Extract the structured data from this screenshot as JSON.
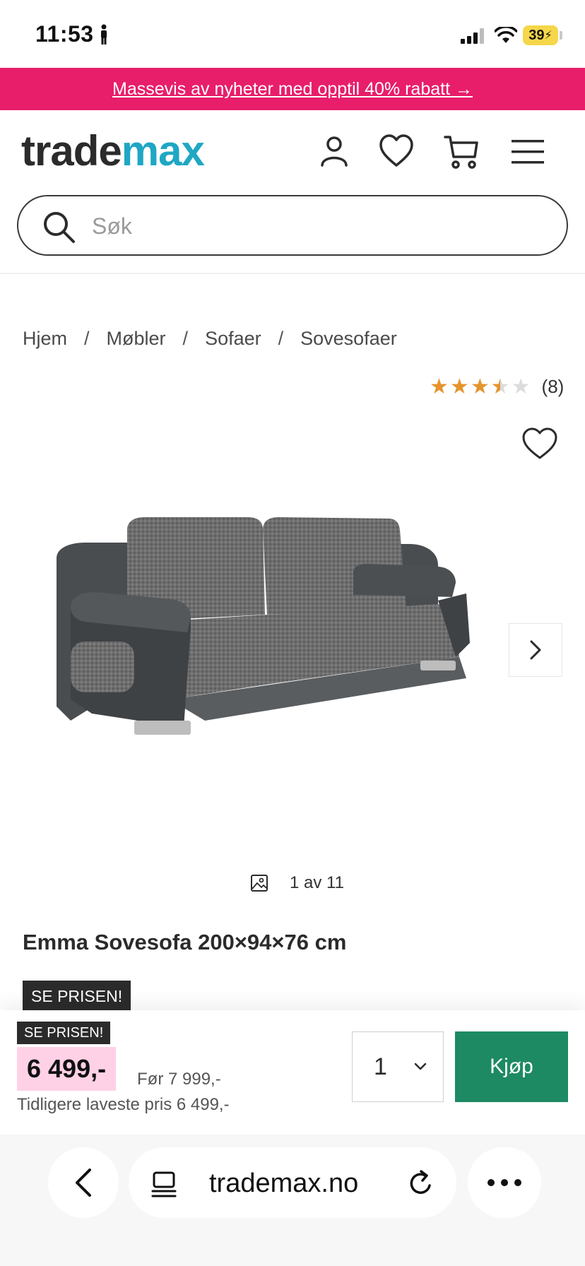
{
  "status_bar": {
    "time": "11:53",
    "battery": "39"
  },
  "promo": {
    "text": "Massevis av nyheter med opptil 40% rabatt →"
  },
  "header": {
    "logo_part1": "trade",
    "logo_part2": "max"
  },
  "search": {
    "placeholder": "Søk"
  },
  "breadcrumb": {
    "items": [
      "Hjem",
      "Møbler",
      "Sofaer",
      "Sovesofaer"
    ],
    "separator": "/"
  },
  "rating": {
    "value": 3.5,
    "max": 5,
    "count": "(8)"
  },
  "gallery": {
    "counter": "1 av 11"
  },
  "product": {
    "title": "Emma Sovesofa 200×94×76 cm",
    "badge": "SE PRISEN!"
  },
  "buy_bar": {
    "badge": "SE PRISEN!",
    "price": "6 499,-",
    "before_price": "Før 7 999,-",
    "lowest_price": "Tidligere laveste pris 6 499,-",
    "quantity": "1",
    "buy_label": "Kjøp"
  },
  "browser": {
    "url": "trademax.no"
  },
  "colors": {
    "promo_bg": "#e81e6b",
    "logo_blue": "#1fa7c4",
    "buy_button": "#1d8a63",
    "price_highlight": "#ffd1e6",
    "star": "#e5942c"
  }
}
